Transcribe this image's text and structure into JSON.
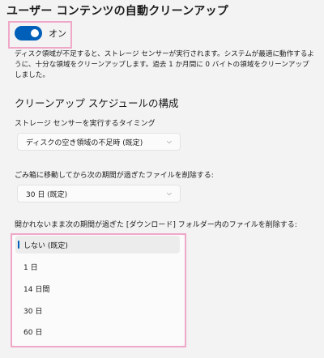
{
  "storage": {
    "title": "ユーザー コンテンツの自動クリーンアップ",
    "toggle_label": "オン",
    "description": "ディスク領域が不足すると、ストレージ センサーが実行されます。システムが最適に動作するように、十分な領域をクリーンアップします。過去 1 か月間に 0 バイトの領域をクリーンアップしました。"
  },
  "schedule": {
    "section_title": "クリーンアップ スケジュールの構成",
    "run_label": "ストレージ センサーを実行するタイミング",
    "run_value": "ディスクの空き領域の不足時 (既定)",
    "recycle_label": "ごみ箱に移動してから次の期間が過ぎたファイルを削除する:",
    "recycle_value": "30 日 (既定)",
    "downloads_label": "開かれないまま次の期間が過ぎた [ダウンロード] フォルダー内のファイルを削除する:",
    "downloads_options": [
      "しない (既定)",
      "1 日",
      "14 日間",
      "30 日",
      "60 日"
    ]
  },
  "icons": {
    "chevron": "chevron-down-icon"
  },
  "colors": {
    "accent": "#005fb8",
    "highlight": "#f0a8c8"
  }
}
